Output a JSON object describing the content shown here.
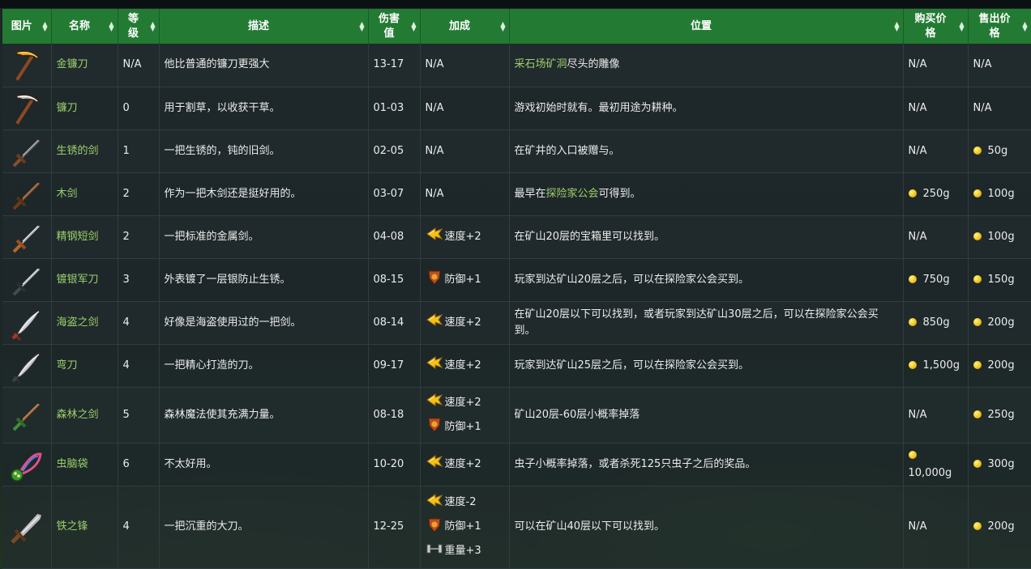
{
  "header": {
    "image": "图片",
    "name": "名称",
    "level_1": "等",
    "level_2": "级",
    "desc": "描述",
    "dmg_1": "伤害",
    "dmg_2": "值",
    "bonus": "加成",
    "location": "位置",
    "buy_1": "购买价",
    "buy_2": "格",
    "sell_1": "售出价",
    "sell_2": "格"
  },
  "icons": {
    "sort": "sort-icon",
    "speed": "speed-icon",
    "defense": "defense-icon",
    "weight": "weight-icon",
    "coin": "gold-coin-icon"
  },
  "colors": {
    "header_bg": "#237b33",
    "link": "#9ccf6d",
    "coin": "#f3c419"
  },
  "rows": [
    {
      "name": "金镰刀",
      "level": "N/A",
      "desc": "他比普通的镰刀更强大",
      "damage": "13-17",
      "bonus": [
        {
          "text": "N/A"
        }
      ],
      "location": {
        "link": "采石场矿洞",
        "rest": "尽头的雕像"
      },
      "buy": "N/A",
      "sell": "N/A"
    },
    {
      "name": "镰刀",
      "level": "0",
      "desc": "用于割草，以收获干草。",
      "damage": "01-03",
      "bonus": [
        {
          "text": "N/A"
        }
      ],
      "location": {
        "text": "游戏初始时就有。最初用途为耕种。"
      },
      "buy": "N/A",
      "sell": "N/A"
    },
    {
      "name": "生锈的剑",
      "level": "1",
      "desc": "一把生锈的，钝的旧剑。",
      "damage": "02-05",
      "bonus": [
        {
          "text": "N/A"
        }
      ],
      "location": {
        "text": "在矿井的入口被赠与。"
      },
      "buy": "N/A",
      "sell": "50g"
    },
    {
      "name": "木剑",
      "level": "2",
      "desc": "作为一把木剑还是挺好用的。",
      "damage": "03-07",
      "bonus": [
        {
          "text": "N/A"
        }
      ],
      "location": {
        "pre": "最早在",
        "link": "探险家公会",
        "rest": "可得到。"
      },
      "buy": "250g",
      "sell": "100g"
    },
    {
      "name": "精钢短剑",
      "level": "2",
      "desc": "一把标准的金属剑。",
      "damage": "04-08",
      "bonus": [
        {
          "icon": "speed",
          "text": "速度+2"
        }
      ],
      "location": {
        "text": "在矿山20层的宝箱里可以找到。"
      },
      "buy": "N/A",
      "sell": "100g"
    },
    {
      "name": "镀银军刀",
      "level": "3",
      "desc": "外表镀了一层银防止生锈。",
      "damage": "08-15",
      "bonus": [
        {
          "icon": "defense",
          "text": "防御+1"
        }
      ],
      "location": {
        "text": "玩家到达矿山20层之后，可以在探险家公会买到。"
      },
      "buy": "750g",
      "sell": "150g"
    },
    {
      "name": "海盗之剑",
      "level": "4",
      "desc": "好像是海盗使用过的一把剑。",
      "damage": "08-14",
      "bonus": [
        {
          "icon": "speed",
          "text": "速度+2"
        }
      ],
      "location": {
        "text": "在矿山20层以下可以找到，或者玩家到达矿山30层之后，可以在探险家公会买到。"
      },
      "buy": "850g",
      "sell": "200g"
    },
    {
      "name": "弯刀",
      "level": "4",
      "desc": "一把精心打造的刀。",
      "damage": "09-17",
      "bonus": [
        {
          "icon": "speed",
          "text": "速度+2"
        }
      ],
      "location": {
        "text": "玩家到达矿山25层之后，可以在探险家公会买到。"
      },
      "buy": "1,500g",
      "sell": "200g"
    },
    {
      "name": "森林之剑",
      "level": "5",
      "desc": "森林魔法使其充满力量。",
      "damage": "08-18",
      "bonus": [
        {
          "icon": "speed",
          "text": "速度+2"
        },
        {
          "icon": "defense",
          "text": "防御+1"
        }
      ],
      "location": {
        "text": "矿山20层-60层小概率掉落"
      },
      "buy": "N/A",
      "sell": "250g"
    },
    {
      "name": "虫脑袋",
      "level": "6",
      "desc": "不太好用。",
      "damage": "10-20",
      "bonus": [
        {
          "icon": "speed",
          "text": "速度+2"
        }
      ],
      "location": {
        "text": "虫子小概率掉落，或者杀死125只虫子之后的奖品。"
      },
      "buy": "10,000g",
      "sell": "300g"
    },
    {
      "name": "铁之锋",
      "level": "4",
      "desc": "一把沉重的大刀。",
      "damage": "12-25",
      "bonus": [
        {
          "icon": "speed",
          "text": "速度-2"
        },
        {
          "icon": "defense",
          "text": "防御+1"
        },
        {
          "icon": "weight",
          "text": "重量+3"
        }
      ],
      "location": {
        "text": "可以在矿山40层以下可以找到。"
      },
      "buy": "N/A",
      "sell": "200g"
    }
  ]
}
